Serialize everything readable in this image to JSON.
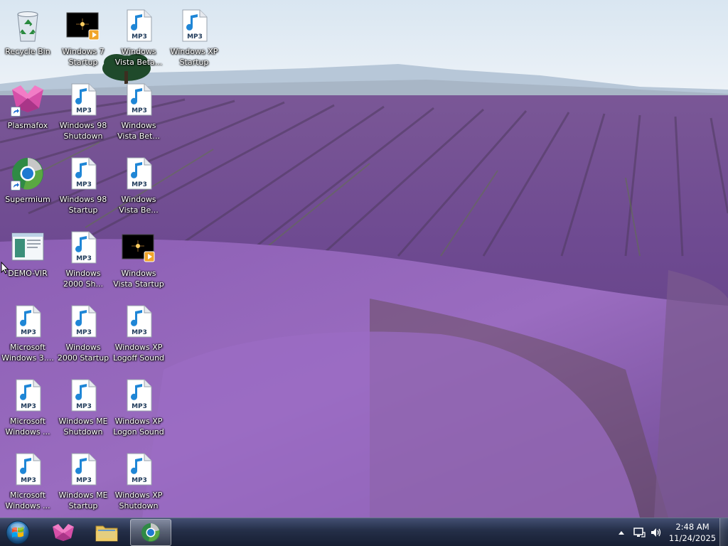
{
  "desktop": {
    "icons": [
      {
        "label": "Recycle Bin",
        "icon": "recycle-bin-icon"
      },
      {
        "label": "Windows 7 Startup",
        "icon": "video-file-icon"
      },
      {
        "label": "Windows Vista Beta...",
        "icon": "mp3-file-icon"
      },
      {
        "label": "Windows XP Startup",
        "icon": "mp3-file-icon"
      },
      {
        "label": "Plasmafox",
        "icon": "plasmafox-icon"
      },
      {
        "label": "Windows 98 Shutdown",
        "icon": "mp3-file-icon"
      },
      {
        "label": "Windows Vista Bet...",
        "icon": "mp3-file-icon"
      },
      {
        "label": "Supermium",
        "icon": "supermium-icon"
      },
      {
        "label": "Windows 98 Startup",
        "icon": "mp3-file-icon"
      },
      {
        "label": "Windows Vista Be...",
        "icon": "mp3-file-icon"
      },
      {
        "label": "DEMO-VIR",
        "icon": "app-window-icon"
      },
      {
        "label": "Windows 2000 Sh...",
        "icon": "mp3-file-icon"
      },
      {
        "label": "Windows Vista Startup",
        "icon": "video-file-icon"
      },
      {
        "label": "Microsoft Windows 3....",
        "icon": "mp3-file-icon"
      },
      {
        "label": "Windows 2000 Startup",
        "icon": "mp3-file-icon"
      },
      {
        "label": "Windows XP Logoff Sound",
        "icon": "mp3-file-icon"
      },
      {
        "label": "Microsoft Windows ...",
        "icon": "mp3-file-icon"
      },
      {
        "label": "Windows ME Shutdown",
        "icon": "mp3-file-icon"
      },
      {
        "label": "Windows XP Logon Sound",
        "icon": "mp3-file-icon"
      },
      {
        "label": "Microsoft Windows ...",
        "icon": "mp3-file-icon"
      },
      {
        "label": "Windows ME Startup",
        "icon": "mp3-file-icon"
      },
      {
        "label": "Windows XP Shutdown",
        "icon": "mp3-file-icon"
      }
    ],
    "mp3_badge": "MP3"
  },
  "taskbar": {
    "start": "windows-start-orb-icon",
    "pinned": [
      {
        "name": "plasmafox",
        "icon": "plasmafox-icon"
      },
      {
        "name": "file-explorer",
        "icon": "folder-icon"
      },
      {
        "name": "supermium",
        "icon": "supermium-icon",
        "active": true
      }
    ],
    "tray": [
      "show-hidden-icons-arrow",
      "network-icon",
      "volume-icon"
    ],
    "clock": {
      "time": "2:48 AM",
      "date": "11/24/2025"
    }
  },
  "colors": {
    "taskbar": "#1e2c42",
    "lavender": "#8a5fb0",
    "sky": "#dfe9f2"
  }
}
